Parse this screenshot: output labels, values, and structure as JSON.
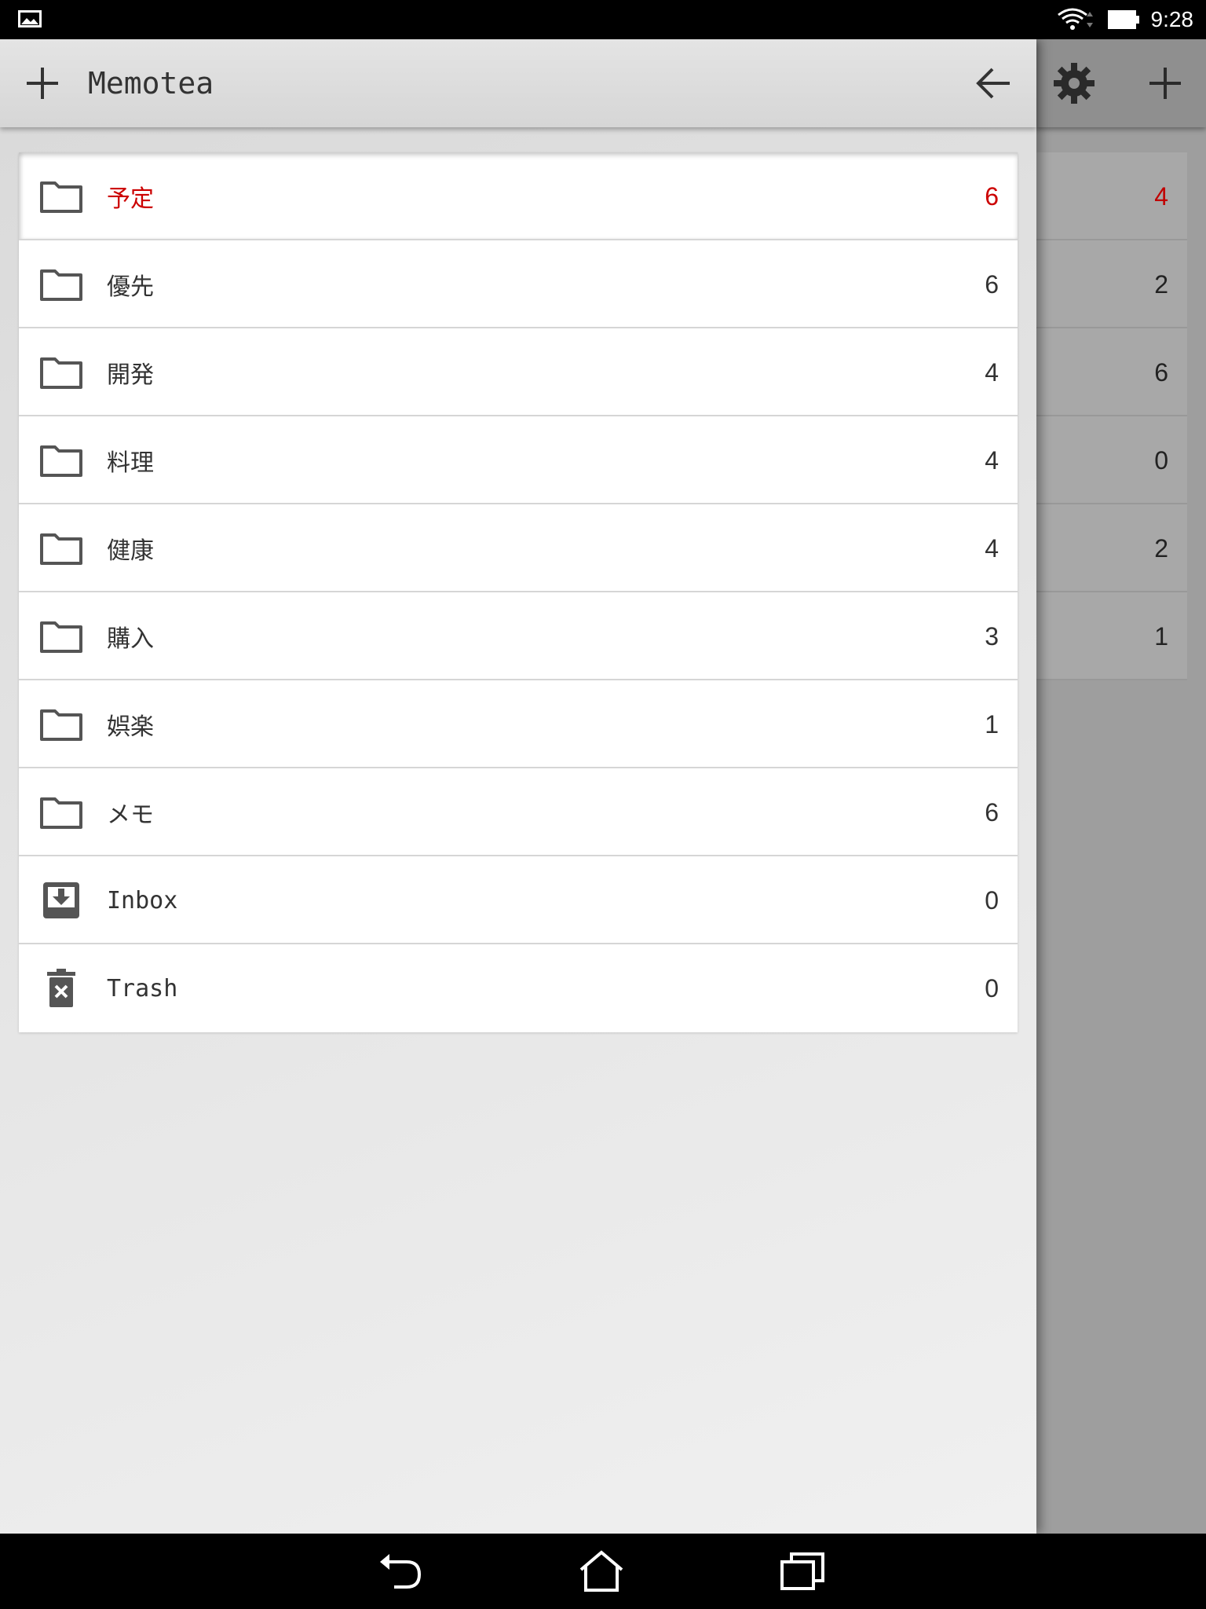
{
  "status_bar": {
    "time": "9:28",
    "icons": [
      "gallery-icon",
      "wifi-icon",
      "battery-icon"
    ]
  },
  "drawer": {
    "title": "Memotea",
    "add_icon": "plus-icon",
    "back_icon": "arrow-left-icon",
    "folders": [
      {
        "label": "予定",
        "count": "6",
        "icon": "folder-icon",
        "selected": true
      },
      {
        "label": "優先",
        "count": "6",
        "icon": "folder-icon"
      },
      {
        "label": "開発",
        "count": "4",
        "icon": "folder-icon"
      },
      {
        "label": "料理",
        "count": "4",
        "icon": "folder-icon"
      },
      {
        "label": "健康",
        "count": "4",
        "icon": "folder-icon"
      },
      {
        "label": "購入",
        "count": "3",
        "icon": "folder-icon"
      },
      {
        "label": "娯楽",
        "count": "1",
        "icon": "folder-icon"
      },
      {
        "label": "メモ",
        "count": "6",
        "icon": "folder-icon"
      },
      {
        "label": "Inbox",
        "count": "0",
        "icon": "inbox-icon"
      },
      {
        "label": "Trash",
        "count": "0",
        "icon": "trash-icon"
      }
    ]
  },
  "background_screen": {
    "icons": [
      "gear-icon",
      "plus-icon"
    ],
    "counts": [
      "4",
      "2",
      "6",
      "0",
      "2",
      "1"
    ]
  },
  "navigation": {
    "icons": [
      "back-icon",
      "home-icon",
      "recents-icon"
    ]
  },
  "colors": {
    "accent": "#cc0000",
    "text": "#333333",
    "divider": "#d6d6d6"
  }
}
